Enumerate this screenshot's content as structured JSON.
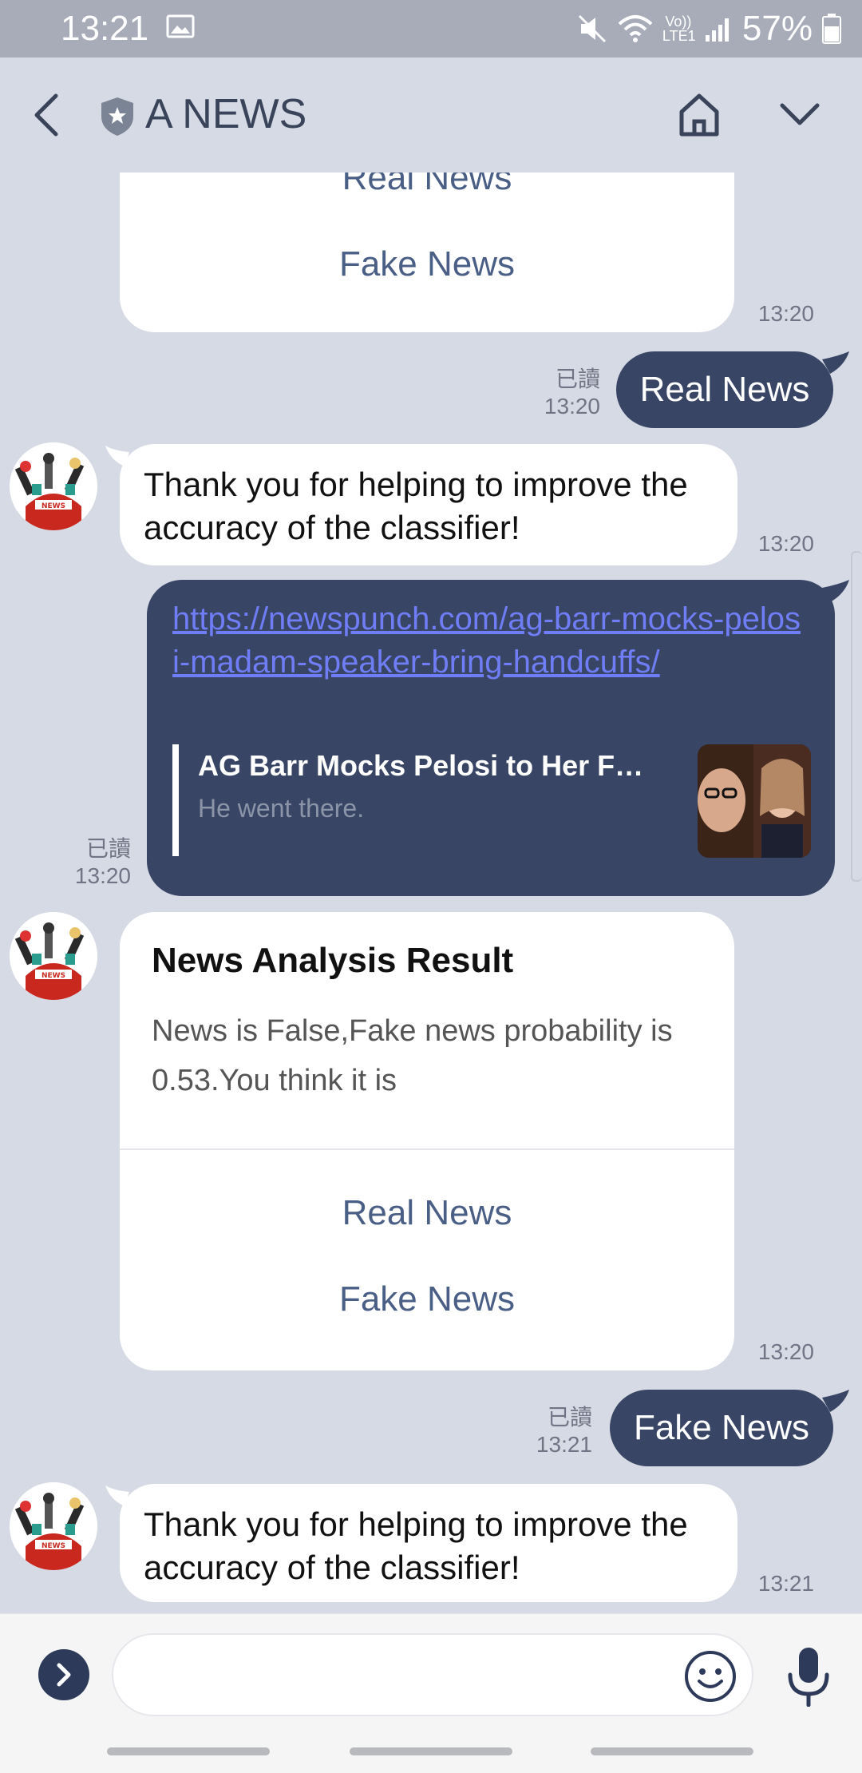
{
  "status_bar": {
    "time": "13:21",
    "battery": "57%",
    "icons": [
      "image-icon",
      "mute-icon",
      "wifi-icon",
      "volte-icon",
      "signal-icon",
      "battery-icon"
    ],
    "volte_text": "Vo)) LTE1"
  },
  "header": {
    "title": "A NEWS",
    "icons": [
      "back-arrow-icon",
      "shield-star-icon",
      "home-icon",
      "chevron-down-icon"
    ]
  },
  "messages": {
    "m1": {
      "options": [
        "Real News",
        "Fake News"
      ],
      "time": "13:20"
    },
    "m2": {
      "text": "Real News",
      "read": "已讀",
      "time": "13:20"
    },
    "m3": {
      "text": "Thank you for helping to improve the accuracy of the classifier!",
      "time": "13:20"
    },
    "m4": {
      "url": "https://newspunch.com/ag-barr-mocks-pelosi-madam-speaker-bring-handcuffs/",
      "preview_title": "AG Barr Mocks Pelosi to Her Fa...",
      "preview_desc": "He went there.",
      "read": "已讀",
      "time": "13:20"
    },
    "m5": {
      "title": "News Analysis Result",
      "body": "News is False,Fake news probability is 0.53.You think it is",
      "options": [
        "Real News",
        "Fake News"
      ],
      "time": "13:20"
    },
    "m6": {
      "text": "Fake News",
      "read": "已讀",
      "time": "13:21"
    },
    "m7": {
      "text": "Thank you for helping to improve the accuracy of the classifier!",
      "time": "13:21"
    }
  },
  "avatar": {
    "banner_text": "NEWS"
  },
  "input": {
    "placeholder": "",
    "icons": [
      "expand-arrow-icon",
      "emoji-icon",
      "microphone-icon"
    ]
  },
  "colors": {
    "background": "#d6dae4",
    "outgoing_bubble": "#384565",
    "link": "#6f7df6",
    "option_text": "#4a5f86"
  }
}
